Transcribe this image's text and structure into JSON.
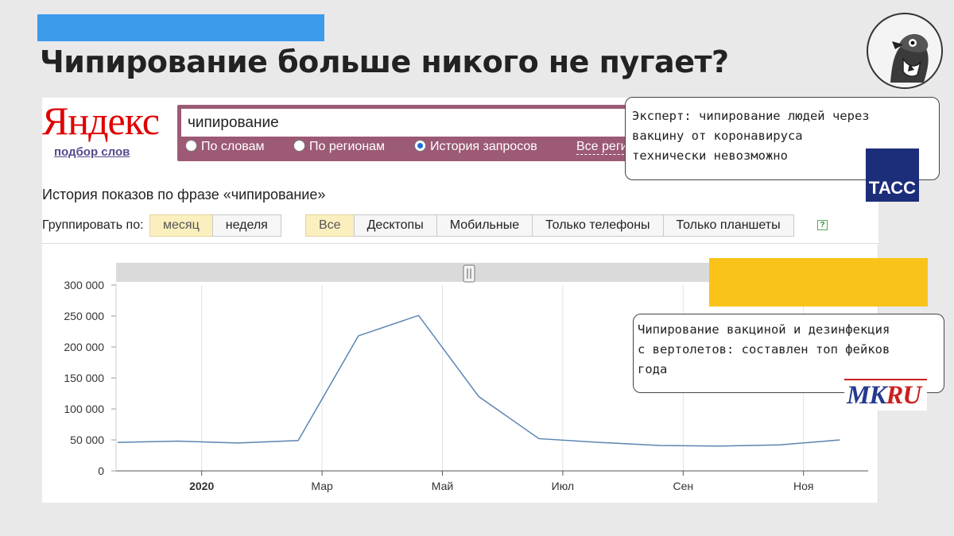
{
  "slide": {
    "title": "Чипирование больше никого не пугает?"
  },
  "colors": {
    "accent_bar": "#3d9bec",
    "yellow_block": "#f9c31a",
    "line": "#5b84b1",
    "yandex_red": "#e00000",
    "search_bg": "#9c5a76",
    "tass_blue": "#1c2d7a"
  },
  "yandex": {
    "logo": "Яндекс",
    "wordstat_link": "подбор слов",
    "search_value": "чипирование",
    "search_options": [
      {
        "label": "По словам",
        "selected": false
      },
      {
        "label": "По регионам",
        "selected": false
      },
      {
        "label": "История запросов",
        "selected": true
      }
    ],
    "all_regions": "Все реги",
    "history_title": "История показов по фразе «чипирование»",
    "group_label": "Группировать по:",
    "group_buttons": [
      {
        "label": "месяц",
        "active": true
      },
      {
        "label": "неделя",
        "active": false
      }
    ],
    "device_buttons": [
      {
        "label": "Все",
        "active": true
      },
      {
        "label": "Десктопы",
        "active": false
      },
      {
        "label": "Мобильные",
        "active": false
      },
      {
        "label": "Только телефоны",
        "active": false
      },
      {
        "label": "Только планшеты",
        "active": false
      }
    ],
    "help": "?"
  },
  "callouts": {
    "tass": {
      "text": "Эксперт: чипирование людей через\nвакцину от коронавируса\nтехнически невозможно",
      "logo": "ТАСС"
    },
    "mk": {
      "text": "Чипирование вакциной и дезинфекция\nс вертолетов: составлен топ фейков\nгода",
      "logo_m": "MK",
      "logo_r": "RU"
    }
  },
  "chart_data": {
    "type": "line",
    "title": "",
    "xlabel": "",
    "ylabel": "",
    "ylim": [
      0,
      300000
    ],
    "y_ticks": [
      "0",
      "50 000",
      "100 000",
      "150 000",
      "200 000",
      "250 000",
      "300 000"
    ],
    "x_tick_labels": [
      "2020",
      "Мар",
      "Май",
      "Июл",
      "Сен",
      "Ноя"
    ],
    "x": [
      "2019-12",
      "2020-01",
      "2020-02",
      "2020-03",
      "2020-04",
      "2020-05",
      "2020-06",
      "2020-07",
      "2020-08",
      "2020-09",
      "2020-10",
      "2020-11",
      "2020-12"
    ],
    "values": [
      46000,
      48000,
      45000,
      49000,
      218000,
      251000,
      120000,
      52000,
      46000,
      41000,
      40000,
      42000,
      50000
    ],
    "grid": true
  }
}
